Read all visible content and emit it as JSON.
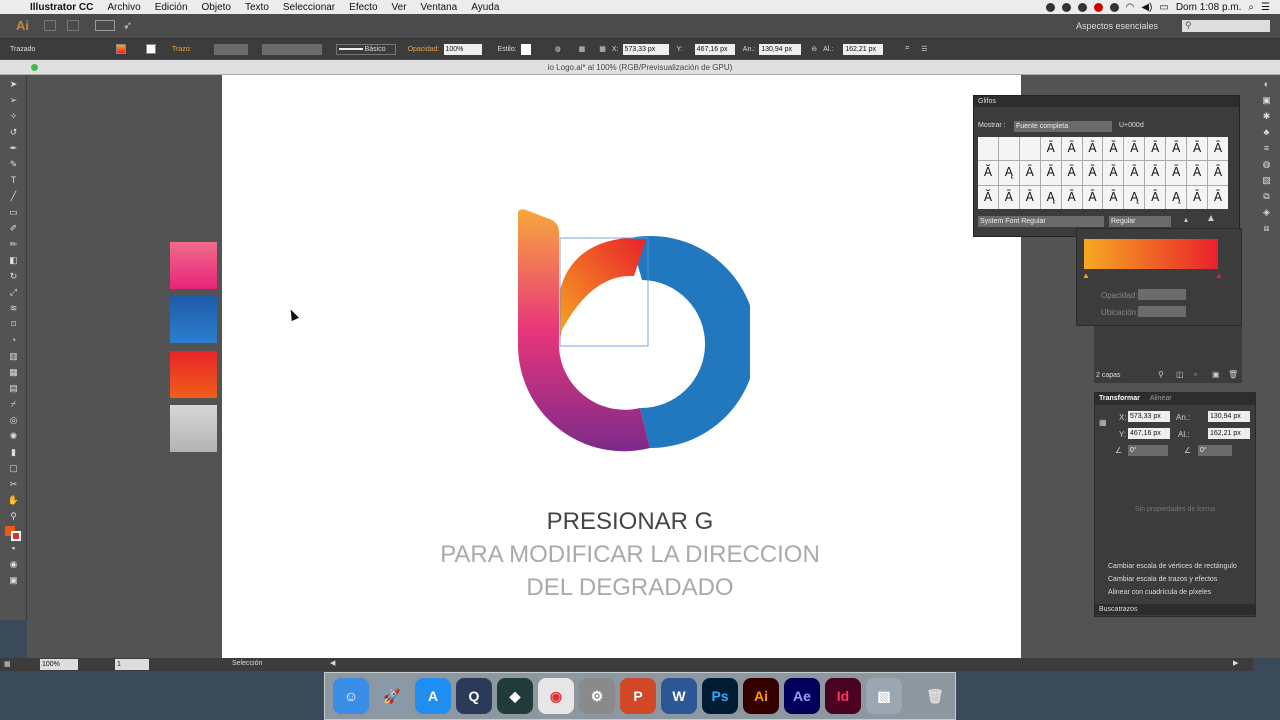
{
  "menubar": {
    "app_name": "Illustrator CC",
    "menus": [
      "Archivo",
      "Edición",
      "Objeto",
      "Texto",
      "Seleccionar",
      "Efecto",
      "Ver",
      "Ventana",
      "Ayuda"
    ],
    "clock": "Dom 1:08 p.m."
  },
  "appbar": {
    "logo": "Ai",
    "workspace": "Aspectos esenciales",
    "search_placeholder": ""
  },
  "control": {
    "mode": "Trazado",
    "stroke_label": "Trazo:",
    "stroke_style": "Básico",
    "opacity_label": "Opacidad:",
    "opacity": "100%",
    "style_label": "Estilo:",
    "x_label": "X:",
    "x": "573,33 px",
    "y_label": "Y:",
    "y": "467,16 px",
    "w_label": "An.:",
    "w": "130,94 px",
    "h_label": "Al.:",
    "h": "162,21 px"
  },
  "document": {
    "tab_title": "io Logo.ai* al 100% (RGB/Previsualización de GPU)",
    "zoom": "100%",
    "page": "1",
    "status_tool": "Selección"
  },
  "artboard": {
    "line1": "PRESIONAR G",
    "line2": "PARA MODIFICAR LA DIRECCION",
    "line3": "DEL DEGRADADO"
  },
  "glyphs": {
    "title": "Glifos",
    "show_label": "Mostrar :",
    "show_value": "Fuente completa",
    "code": "U+000d",
    "font": "System Font Regular",
    "style": "Regular",
    "chars": [
      "",
      "",
      "",
      "Ā",
      "Ā",
      "Ā",
      "Ā",
      "Ā",
      "Ā",
      "Ā",
      "Ā",
      "Ā",
      "Ă",
      "Ą",
      "Ā",
      "Ā",
      "Ā",
      "Ā",
      "Ā",
      "Ā",
      "Ā",
      "Ā",
      "Ā",
      "Ā",
      "Ă",
      "Ā",
      "Ā",
      "Ą",
      "Ā",
      "Ā",
      "Ā",
      "Ą",
      "Ā",
      "Ą",
      "Ā",
      "Ā"
    ]
  },
  "gradient": {
    "opacity_label": "Opacidad:",
    "location_label": "Ubicación:",
    "start_color": "#f7a823",
    "end_color": "#e8212a"
  },
  "layers": {
    "count": "2 capas"
  },
  "transform": {
    "tab_active": "Transformar",
    "tab_other": "Alinear",
    "x_label": "X:",
    "x": "573,33 px",
    "w_label": "An.:",
    "w": "130,94 px",
    "y_label": "Y:",
    "y": "467,16 px",
    "h_label": "Al.:",
    "h": "162,21 px",
    "angle": "0°",
    "shear": "0°",
    "no_props": "Sin propiedades de forma",
    "opt1": "Cambiar escala de vértices de rectángulo",
    "opt2": "Cambiar escala de trazos y efectos",
    "opt3": "Alinear con cuadrícula de píxeles",
    "buscatrazos": "Buscatrazos"
  },
  "colors": {
    "swatch1": "#ee3e7a",
    "swatch2": "#1d5fb0",
    "swatch3": "#ea3a25",
    "swatch4": "#c4c4c4",
    "blue": "#2178bf"
  },
  "dock": [
    "Finder",
    "Launchpad",
    "App Store",
    "QuickTime",
    "Filmora",
    "Chrome",
    "Preferencias",
    "PowerPoint",
    "Word",
    "Ps",
    "Ai",
    "Ae",
    "Id",
    "Vista Previa",
    "Papelera"
  ]
}
